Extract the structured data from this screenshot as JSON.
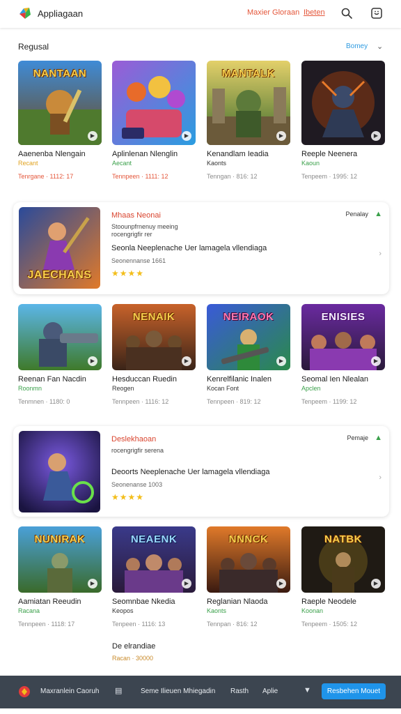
{
  "header": {
    "app_title": "Appliagaan",
    "links": [
      "Maxier Gloraan",
      "Ibeten"
    ],
    "icons": [
      "search-icon",
      "chat-icon"
    ],
    "accent_color": "#e4563a"
  },
  "section": {
    "title": "Regusal",
    "sort_label": "Bomey"
  },
  "rows": [
    {
      "tiles": [
        {
          "thumb_title": "NANTAAN",
          "name": "Aaenenba Nlengain",
          "sub": "Recant",
          "sub_color": "#e0a21e",
          "meta": "Tenrgane · 1112: 17",
          "meta_color": "#e4563a"
        },
        {
          "thumb_title": "",
          "name": "Aplinlenan Nlenglin",
          "sub": "Aecant",
          "sub_color": "#3aa04a",
          "meta": "Tennpeen · 1111: 12",
          "meta_color": "#e4563a"
        },
        {
          "thumb_title": "MANTALK",
          "name": "Kenandlam  Ieadia",
          "sub": "Kaonts",
          "sub_color": "#333333",
          "meta": "Tenngan · 816: 12",
          "meta_color": "#8b8b8b"
        },
        {
          "thumb_title": "",
          "name": "Reeple Neenera",
          "sub": "Kaoun",
          "sub_color": "#3aa04a",
          "meta": "Tenpeem · 1995: 12",
          "meta_color": "#8b8b8b"
        }
      ]
    },
    {
      "tiles": [
        {
          "thumb_title": "",
          "name": "Reenan Fan Nacdin",
          "sub": "Roonmn",
          "sub_color": "#3aa04a",
          "meta": "Tenmnen · 1180: 0",
          "meta_color": "#8b8b8b"
        },
        {
          "thumb_title": "NENAIK",
          "name": "Hesduccan  Ruedin",
          "sub": "Reogen",
          "sub_color": "#333333",
          "meta": "Tennpeen · 1116: 12",
          "meta_color": "#8b8b8b"
        },
        {
          "thumb_title": "NEIRAOK",
          "name": "Kenrelfilanic Inalen",
          "sub": "Kocan  Font",
          "sub_color": "#333333",
          "meta": "Tennpeen · 819: 12",
          "meta_color": "#8b8b8b"
        },
        {
          "thumb_title": "ENISIES",
          "name": "Seomal Ien Nlealan",
          "sub": "Apclen",
          "sub_color": "#3aa04a",
          "meta": "Tenpeem · 1199: 12",
          "meta_color": "#8b8b8b"
        }
      ]
    },
    {
      "tiles": [
        {
          "thumb_title": "NUNIRAK",
          "name": "Aamiatan  Reeudin",
          "sub": "Racana",
          "sub_color": "#3aa04a",
          "meta": "Tennpeen · 1118: 17",
          "meta_color": "#8b8b8b"
        },
        {
          "thumb_title": "NEAENK",
          "name": "Seomnbae  Nkedia",
          "sub": "Keopos",
          "sub_color": "#333333",
          "meta": "Tenpeen · 1116: 13",
          "meta_color": "#8b8b8b"
        },
        {
          "thumb_title": "NNNCK",
          "name": "Reglanian  Nlaoda",
          "sub": "Kaonts",
          "sub_color": "#3aa04a",
          "meta": "Tennpan · 816: 12",
          "meta_color": "#8b8b8b"
        },
        {
          "thumb_title": "NATBK",
          "name": "Raeple Neodele",
          "sub": "Koonan",
          "sub_color": "#3aa04a",
          "meta": "Tenpeem · 1505: 12",
          "meta_color": "#8b8b8b"
        }
      ]
    }
  ],
  "features": [
    {
      "thumb_title": "JAECHANS",
      "title": "Mhaas Neonai",
      "sub": "Stoounpfrnenuy meeing",
      "sub2": "rocengrigfir rer",
      "desc": "Seonla Neeplenache Uer lamagela vllendiaga",
      "meta": "Seonennanse 1661",
      "stars": "★★★★",
      "badge": "Penalay"
    },
    {
      "thumb_title": "",
      "title": "Deslekhaoan",
      "sub": "rocengrigfir serena",
      "sub2": "",
      "desc": "Deoorts Neeplenache Uer lamagela vllendiaga",
      "meta": "Seonenanse 1003",
      "stars": "★★★★",
      "badge": "Pemaje"
    }
  ],
  "extra": {
    "title": "De elrandiae",
    "meta": "Racan · 30000"
  },
  "footer": {
    "brand": "Maxranlein Caoruh",
    "links": [
      "Seme Ilieuen Mhiegadin",
      "Rasth",
      "Aplie"
    ],
    "cta": "Resbehen Mouet"
  }
}
